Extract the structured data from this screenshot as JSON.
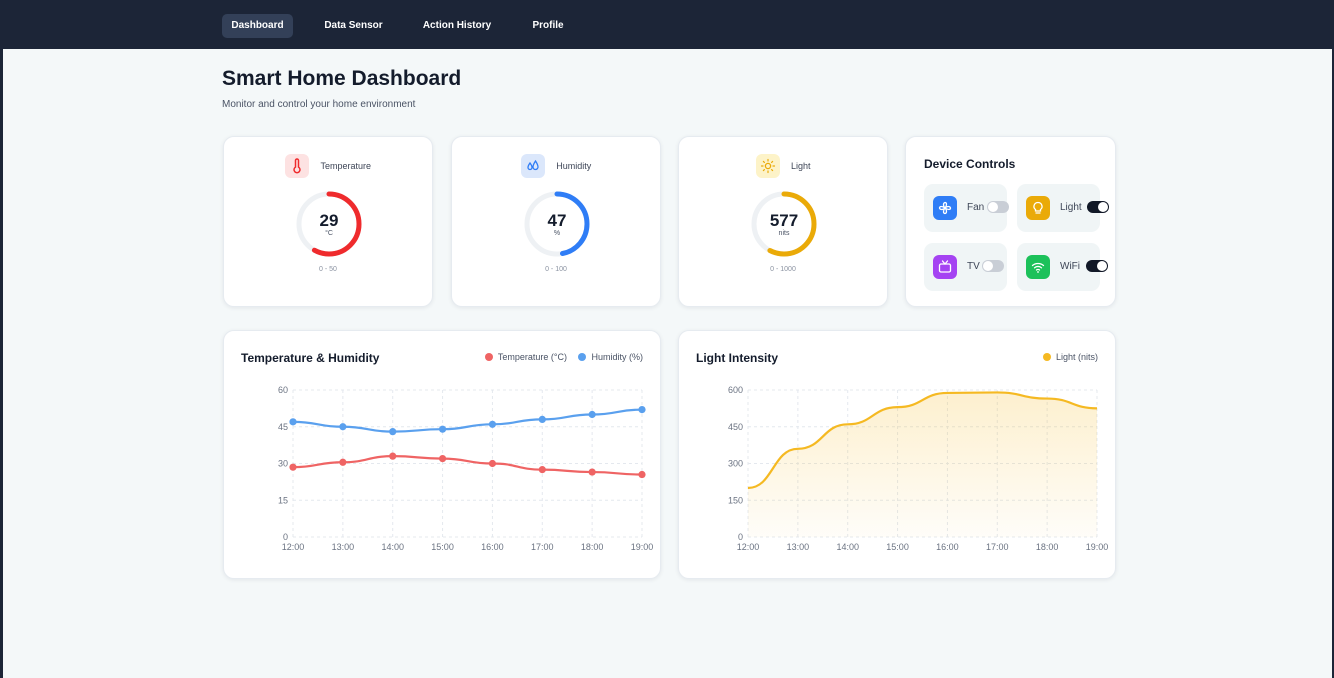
{
  "nav": {
    "items": [
      {
        "label": "Dashboard",
        "active": true
      },
      {
        "label": "Data Sensor",
        "active": false
      },
      {
        "label": "Action History",
        "active": false
      },
      {
        "label": "Profile",
        "active": false
      }
    ]
  },
  "page": {
    "title": "Smart Home Dashboard",
    "subtitle": "Monitor and control your home environment"
  },
  "sensors": {
    "temperature": {
      "name": "Temperature",
      "icon": "thermometer-icon",
      "value": "29",
      "unit": "°C",
      "range": "0 - 50",
      "min": 0,
      "max": 50,
      "color": "#ef2b2d",
      "tint": "#fde2e2"
    },
    "humidity": {
      "name": "Humidity",
      "icon": "droplets-icon",
      "value": "47",
      "unit": "%",
      "range": "0 - 100",
      "min": 0,
      "max": 100,
      "color": "#2f7df6",
      "tint": "#dbe7fb"
    },
    "light": {
      "name": "Light",
      "icon": "sun-icon",
      "value": "577",
      "unit": "nits",
      "range": "0 - 1000",
      "min": 0,
      "max": 1000,
      "color": "#eaaa08",
      "tint": "#fdf3c8"
    }
  },
  "devices": {
    "title": "Device Controls",
    "items": [
      {
        "label": "Fan",
        "icon": "fan-icon",
        "on": false,
        "color": "#2f7df6"
      },
      {
        "label": "Light",
        "icon": "lightbulb-icon",
        "on": true,
        "color": "#eaaa08"
      },
      {
        "label": "TV",
        "icon": "tv-icon",
        "on": false,
        "color": "#a543f2"
      },
      {
        "label": "WiFi",
        "icon": "wifi-icon",
        "on": true,
        "color": "#1cc15a"
      }
    ]
  },
  "chart_data": [
    {
      "type": "line",
      "title": "Temperature & Humidity",
      "x": [
        "12:00",
        "13:00",
        "14:00",
        "15:00",
        "16:00",
        "17:00",
        "18:00",
        "19:00"
      ],
      "ylim": [
        0,
        60
      ],
      "yticks": [
        "0",
        "15",
        "30",
        "45",
        "60"
      ],
      "grid": true,
      "legend_position": "top-right",
      "series": [
        {
          "name": "Temperature (°C)",
          "color": "#ef6464",
          "values": [
            28.5,
            30.5,
            33,
            32,
            30,
            27.5,
            26.5,
            25.5
          ]
        },
        {
          "name": "Humidity (%)",
          "color": "#5aa0ee",
          "values": [
            47,
            45,
            43,
            44,
            46,
            48,
            50,
            52
          ]
        }
      ]
    },
    {
      "type": "area",
      "title": "Light Intensity",
      "x": [
        "12:00",
        "13:00",
        "14:00",
        "15:00",
        "16:00",
        "17:00",
        "18:00",
        "19:00"
      ],
      "ylim": [
        0,
        600
      ],
      "yticks": [
        "0",
        "150",
        "300",
        "450",
        "600"
      ],
      "grid": true,
      "legend_position": "top-right",
      "series": [
        {
          "name": "Light (nits)",
          "color": "#f5b922",
          "values": [
            200,
            360,
            460,
            530,
            588,
            590,
            565,
            525
          ]
        }
      ]
    }
  ]
}
